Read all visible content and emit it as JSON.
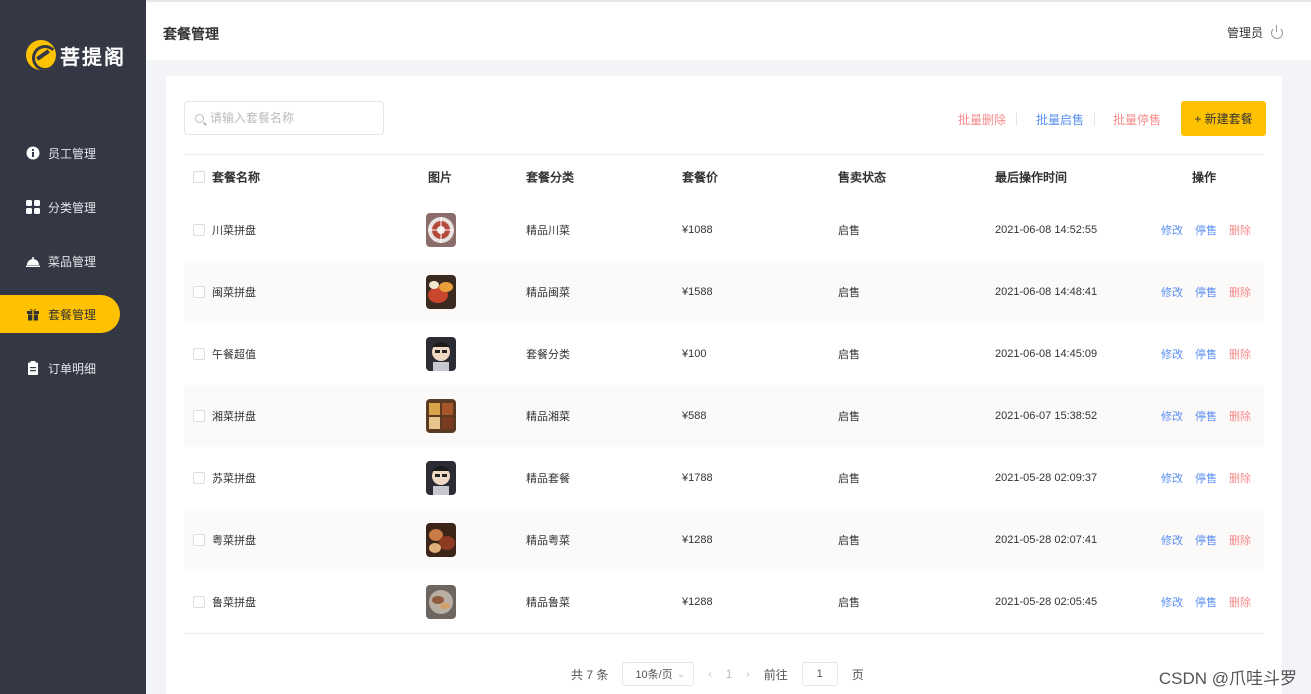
{
  "brand": {
    "name": "菩提阁"
  },
  "sidebar": {
    "items": [
      {
        "label": "员工管理",
        "icon": "info-circle-icon",
        "active": false
      },
      {
        "label": "分类管理",
        "icon": "grid-icon",
        "active": false
      },
      {
        "label": "菜品管理",
        "icon": "cloche-icon",
        "active": false
      },
      {
        "label": "套餐管理",
        "icon": "gift-icon",
        "active": true
      },
      {
        "label": "订单明细",
        "icon": "clipboard-icon",
        "active": false
      }
    ]
  },
  "header": {
    "title": "套餐管理",
    "user": "管理员"
  },
  "toolbar": {
    "search_placeholder": "请输入套餐名称",
    "batch_delete": "批量删除",
    "batch_enable": "批量启售",
    "batch_disable": "批量停售",
    "add_button": "+ 新建套餐"
  },
  "table": {
    "headers": [
      "套餐名称",
      "图片",
      "套餐分类",
      "套餐价",
      "售卖状态",
      "最后操作时间",
      "操作"
    ],
    "rows": [
      {
        "name": "川菜拼盘",
        "category": "精品川菜",
        "price": "¥1088",
        "status": "启售",
        "time": "2021-06-08 14:52:55"
      },
      {
        "name": "闽菜拼盘",
        "category": "精品闽菜",
        "price": "¥1588",
        "status": "启售",
        "time": "2021-06-08 14:48:41"
      },
      {
        "name": "午餐超值",
        "category": "套餐分类",
        "price": "¥100",
        "status": "启售",
        "time": "2021-06-08 14:45:09"
      },
      {
        "name": "湘菜拼盘",
        "category": "精品湘菜",
        "price": "¥588",
        "status": "启售",
        "time": "2021-06-07 15:38:52"
      },
      {
        "name": "苏菜拼盘",
        "category": "精品套餐",
        "price": "¥1788",
        "status": "启售",
        "time": "2021-05-28 02:09:37"
      },
      {
        "name": "粤菜拼盘",
        "category": "精品粤菜",
        "price": "¥1288",
        "status": "启售",
        "time": "2021-05-28 02:07:41"
      },
      {
        "name": "鲁菜拼盘",
        "category": "精品鲁菜",
        "price": "¥1288",
        "status": "启售",
        "time": "2021-05-28 02:05:45"
      }
    ],
    "ops": {
      "edit": "修改",
      "stop": "停售",
      "delete": "删除"
    }
  },
  "pagination": {
    "total": "共 7 条",
    "page_size": "10条/页",
    "current_page": "1",
    "goto_label": "前往",
    "goto_value": "1",
    "page_suffix": "页"
  },
  "watermark": "CSDN @爪哇斗罗",
  "colors": {
    "accent": "#ffc200",
    "sidebar": "#343744",
    "link_blue": "#5a8ff0",
    "link_red": "#f78b8b"
  }
}
